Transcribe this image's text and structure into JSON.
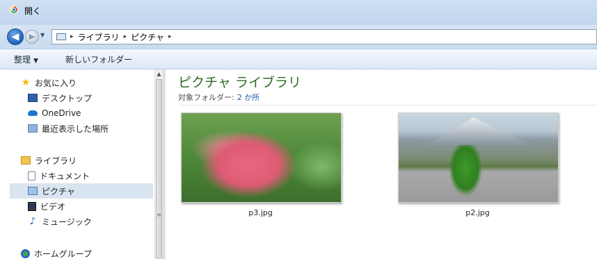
{
  "window": {
    "title": "開く"
  },
  "nav": {
    "back_glyph": "◀",
    "forward_glyph": "▶",
    "history_glyph": "▼",
    "breadcrumb": [
      "ライブラリ",
      "ピクチャ"
    ],
    "separator": "▸"
  },
  "toolbar": {
    "organize_label": "整理",
    "organize_caret": "▼",
    "new_folder_label": "新しいフォルダー"
  },
  "sidebar": {
    "favorites": {
      "label": "お気に入り",
      "items": [
        {
          "label": "デスクトップ",
          "icon": "desktop-icon"
        },
        {
          "label": "OneDrive",
          "icon": "onedrive-icon"
        },
        {
          "label": "最近表示した場所",
          "icon": "recent-places-icon"
        }
      ]
    },
    "libraries": {
      "label": "ライブラリ",
      "items": [
        {
          "label": "ドキュメント",
          "icon": "documents-icon"
        },
        {
          "label": "ピクチャ",
          "icon": "pictures-icon",
          "selected": true
        },
        {
          "label": "ビデオ",
          "icon": "videos-icon"
        },
        {
          "label": "ミュージック",
          "icon": "music-icon"
        }
      ]
    },
    "homegroup": {
      "label": "ホームグループ"
    }
  },
  "content": {
    "title": "ピクチャ ライブラリ",
    "subtitle_label": "対象フォルダー:",
    "subtitle_count": "2 か所",
    "files": [
      {
        "name": "p3.jpg"
      },
      {
        "name": "p2.jpg"
      }
    ]
  },
  "colors": {
    "title_green": "#2b6a20",
    "link_blue": "#1b5fb0",
    "selected_bg": "#d9e4f1"
  }
}
